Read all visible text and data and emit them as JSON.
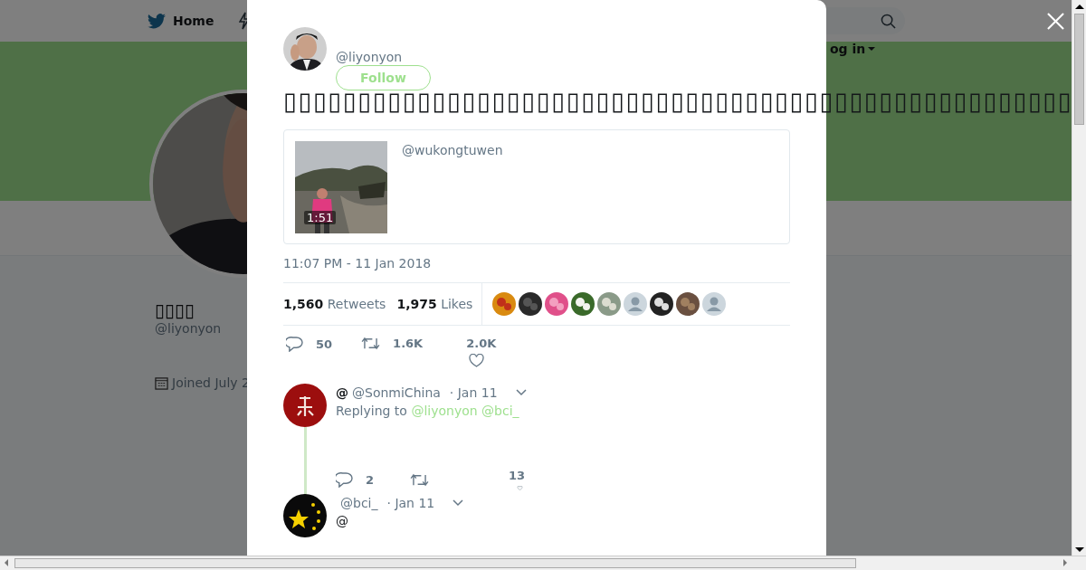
{
  "background_page": {
    "nav": {
      "home": "Home",
      "login": "og in"
    },
    "profile": {
      "name": "▯▯▯▯",
      "handle": "@liyonyon",
      "joined": "Joined July 2"
    }
  },
  "tweet": {
    "author": {
      "handle": "@liyonyon"
    },
    "follow_label": "Follow",
    "text": "▯▯▯▯▯▯▯▯▯▯▯▯▯▯▯▯▯▯▯▯▯▯▯▯▯▯▯▯▯▯▯▯▯▯▯▯▯▯▯▯▯▯▯▯▯▯▯▯▯▯▯▯▯",
    "quoted": {
      "handle": "@wukongtuwen",
      "duration": "1:51"
    },
    "timestamp": "11:07 PM - 11 Jan 2018",
    "stats": [
      {
        "count": "1,560",
        "label": "Retweets"
      },
      {
        "count": "1,975",
        "label": "Likes"
      }
    ],
    "likers": [
      {
        "kind": "picture"
      },
      {
        "kind": "picture"
      },
      {
        "kind": "picture"
      },
      {
        "kind": "picture"
      },
      {
        "kind": "picture"
      },
      {
        "kind": "default"
      },
      {
        "kind": "picture"
      },
      {
        "kind": "picture"
      },
      {
        "kind": "default"
      }
    ],
    "actions": [
      {
        "kind": "reply",
        "count": "50"
      },
      {
        "kind": "retweet",
        "count": "1.6K"
      },
      {
        "kind": "like",
        "count": "2.0K"
      }
    ]
  },
  "replies": [
    {
      "avatar": {
        "kind": "seal"
      },
      "prefix": "@",
      "handle": "@SonmiChina",
      "time": "· Jan 11",
      "replying_to": "Replying to",
      "mentions": [
        "@liyonyon",
        "@bci_"
      ],
      "actions": [
        {
          "kind": "reply",
          "count": "2"
        },
        {
          "kind": "retweet"
        },
        {
          "kind": "like",
          "count": "13"
        }
      ]
    },
    {
      "avatar": {
        "kind": "stars"
      },
      "handle": "@bci_",
      "time": "· Jan 11",
      "text": "@"
    }
  ]
}
